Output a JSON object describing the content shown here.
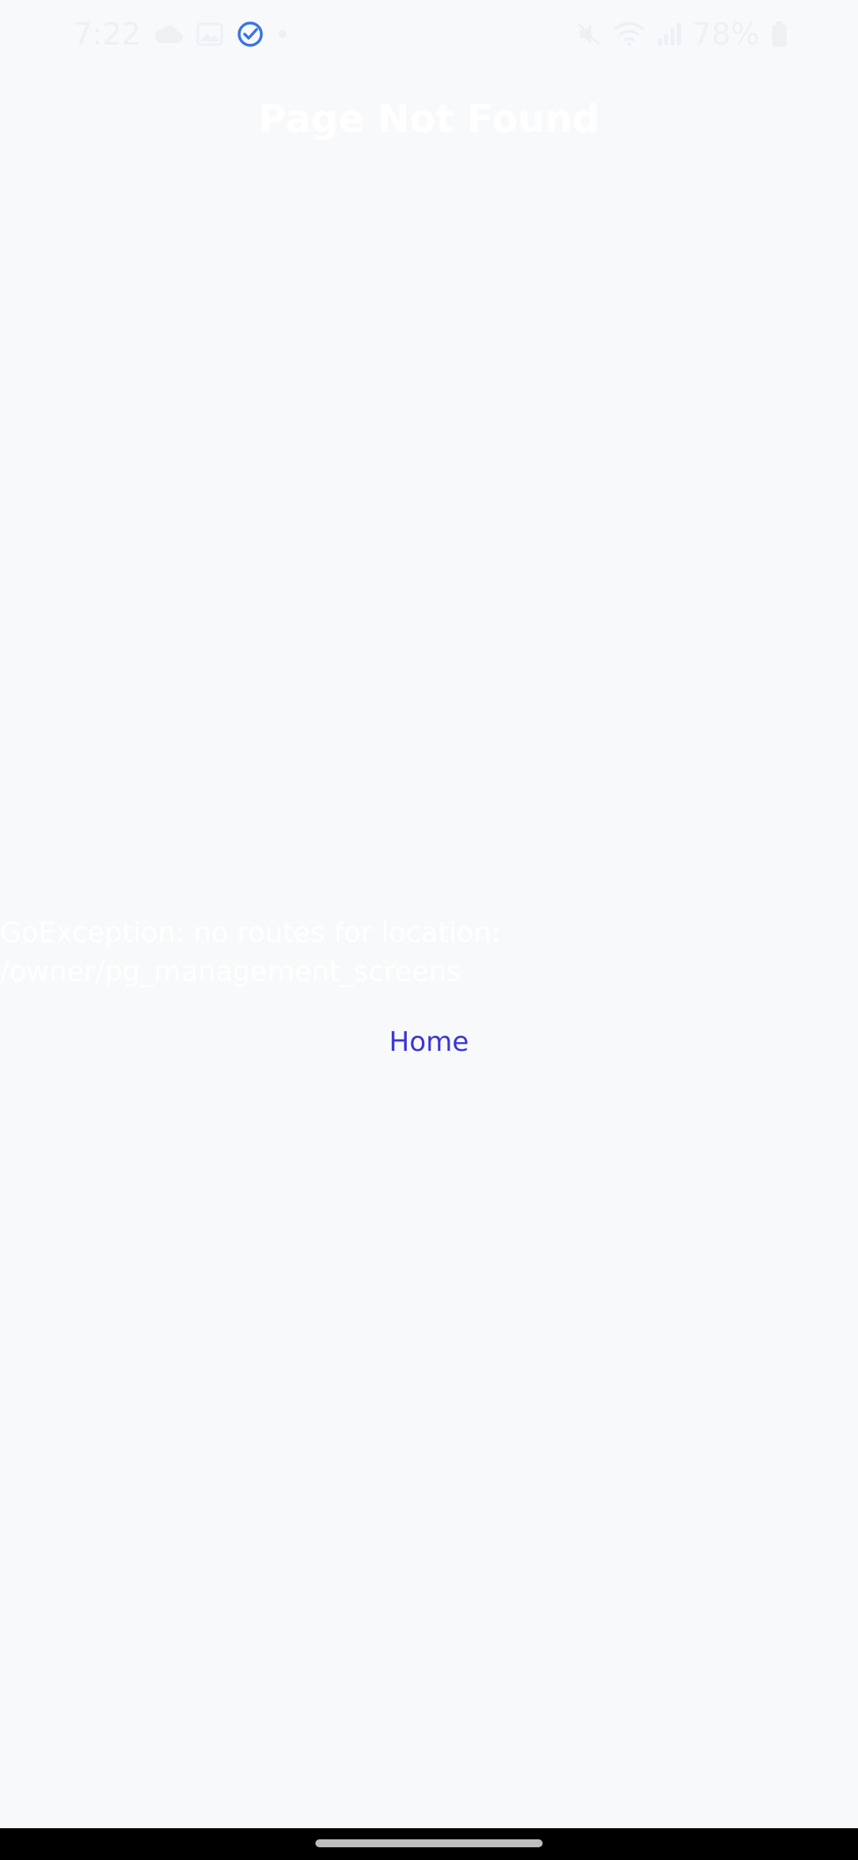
{
  "status_bar": {
    "time": "7:22",
    "battery": "78%",
    "icons_left": [
      "cloud-icon",
      "gallery-icon",
      "check-circle-icon",
      "dot-icon"
    ],
    "icons_right": [
      "mute-icon",
      "wifi-icon",
      "signal-icon",
      "battery-icon"
    ]
  },
  "page": {
    "title": "Page Not Found",
    "error_message": "GoException: no routes for location: /owner/pg_management_screens",
    "home_label": "Home"
  },
  "colors": {
    "background": "#f8f9fb",
    "link": "#3b36d6",
    "check_icon": "#3b73e6"
  }
}
